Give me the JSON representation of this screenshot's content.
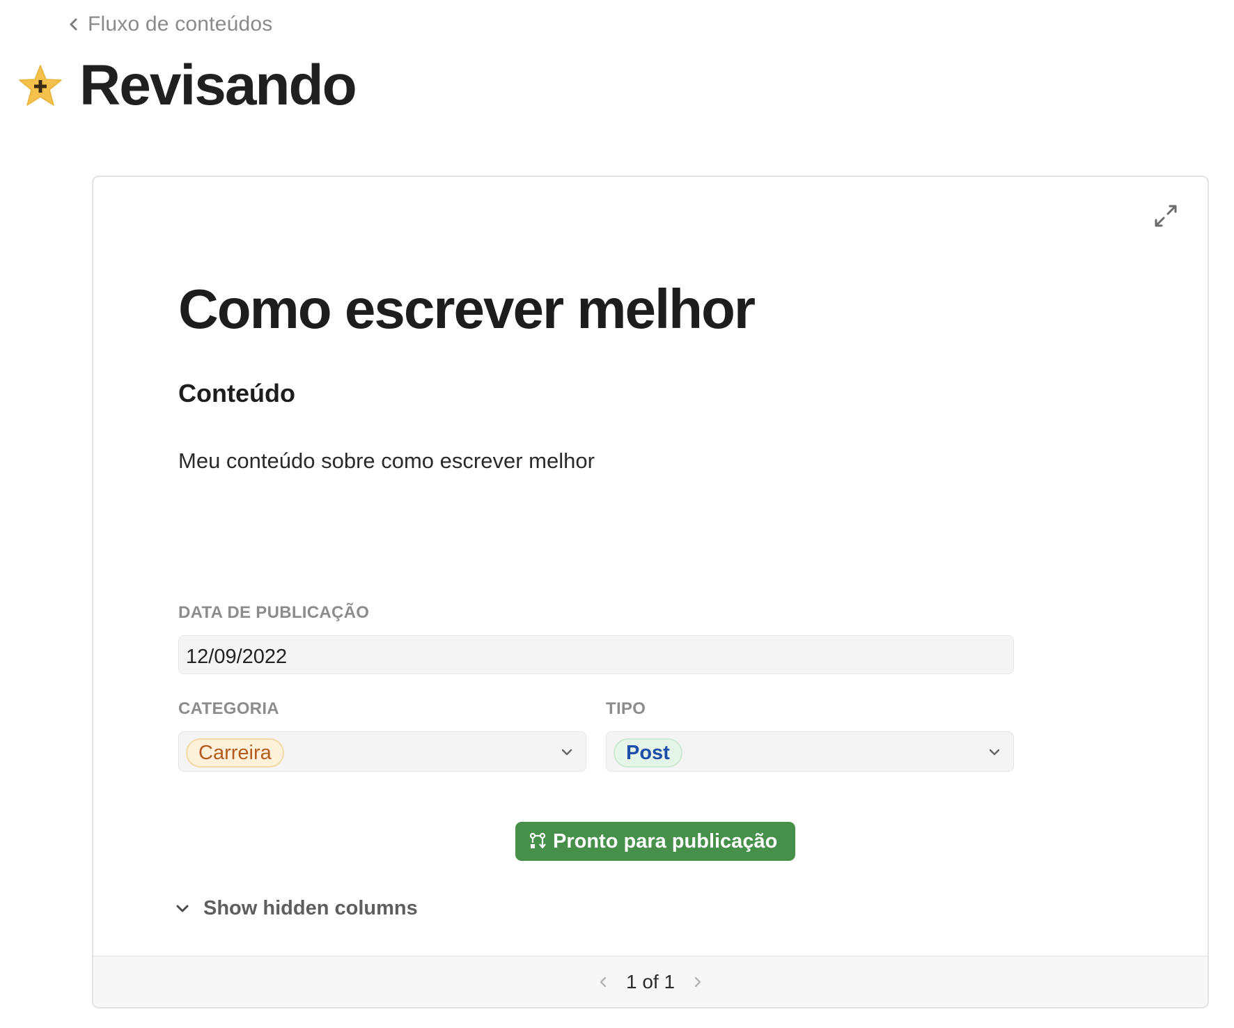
{
  "breadcrumb": {
    "label": "Fluxo de conteúdos",
    "icon": "chevron-left-icon"
  },
  "header": {
    "icon": "star-icon",
    "title": "Revisando"
  },
  "card": {
    "title": "Como escrever melhor",
    "section_heading": "Conteúdo",
    "content_text": "Meu conteúdo sobre como escrever melhor",
    "fields": {
      "publish_date": {
        "label": "DATA DE PUBLICAÇÃO",
        "value": "12/09/2022"
      },
      "category": {
        "label": "CATEGORIA",
        "value": "Carreira"
      },
      "type": {
        "label": "TIPO",
        "value": "Post"
      }
    },
    "action_button": {
      "label": "Pronto para publicação",
      "icon": "workflow-transition-icon"
    },
    "hidden_columns_label": "Show hidden columns",
    "pager": {
      "text": "1 of 1"
    }
  },
  "colors": {
    "primary_button": "#47904b",
    "category_tag_bg": "#fdf1da",
    "category_tag_text": "#b35a1f",
    "type_tag_bg": "#e6f5ea",
    "type_tag_text": "#1e4fa8",
    "star": "#f4c24c"
  }
}
